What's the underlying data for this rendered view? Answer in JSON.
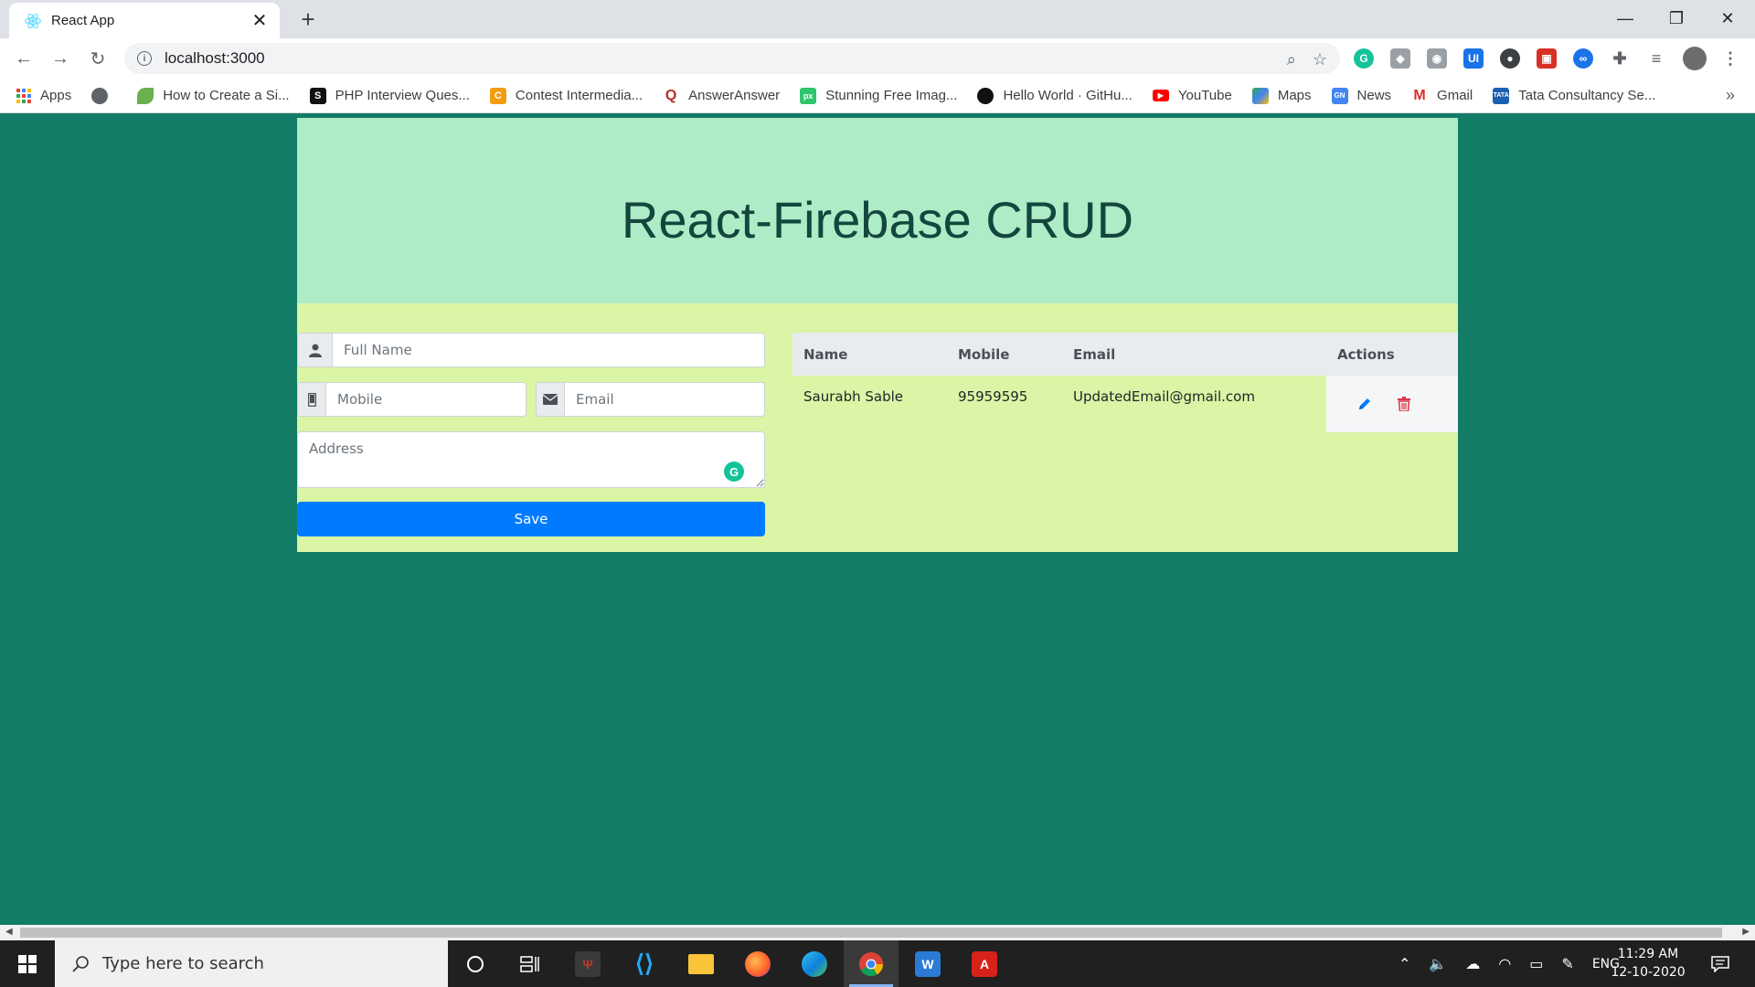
{
  "browser": {
    "tab_title": "React App",
    "url": "localhost:3000",
    "bookmarks": [
      {
        "label": "Apps",
        "icon": "apps-grid-icon",
        "color": "#ea4335"
      },
      {
        "label": "",
        "icon": "globe-icon",
        "color": "#5f6368"
      },
      {
        "label": "How to Create a Si...",
        "icon": "leaf-icon",
        "color": "#6ab04c"
      },
      {
        "label": "PHP Interview Ques...",
        "icon": "s-icon",
        "color": "#111111"
      },
      {
        "label": "Contest Intermedia...",
        "icon": "codechef-icon",
        "color": "#f39c12"
      },
      {
        "label": "AnswerAnswer",
        "icon": "quora-icon",
        "color": "#b92b27"
      },
      {
        "label": "Stunning Free Imag...",
        "icon": "pixabay-icon",
        "color": "#2ec66e"
      },
      {
        "label": "Hello World · GitHu...",
        "icon": "github-icon",
        "color": "#111111"
      },
      {
        "label": "YouTube",
        "icon": "youtube-icon",
        "color": "#ff0000"
      },
      {
        "label": "Maps",
        "icon": "maps-icon",
        "color": "#34a853"
      },
      {
        "label": "News",
        "icon": "news-icon",
        "color": "#4285f4"
      },
      {
        "label": "Gmail",
        "icon": "gmail-icon",
        "color": "#d93025"
      },
      {
        "label": "Tata Consultancy Se...",
        "icon": "tata-icon",
        "color": "#1c5fb0"
      }
    ]
  },
  "page": {
    "title": "React-Firebase CRUD",
    "form": {
      "fullname_placeholder": "Full Name",
      "mobile_placeholder": "Mobile",
      "email_placeholder": "Email",
      "address_placeholder": "Address",
      "save_label": "Save"
    },
    "table": {
      "headers": [
        "Name",
        "Mobile",
        "Email",
        "Actions"
      ],
      "rows": [
        {
          "name": "Saurabh Sable",
          "mobile": "95959595",
          "email": "UpdatedEmail@gmail.com"
        }
      ]
    },
    "colors": {
      "background": "#127c66",
      "jumbotron": "#aeebc7",
      "container": "#d9f5a5",
      "save_button": "#007bff",
      "edit_icon": "#007bff",
      "delete_icon": "#dc3545"
    }
  },
  "taskbar": {
    "search_placeholder": "Type here to search",
    "language": "ENG",
    "time": "11:29 AM",
    "date": "12-10-2020"
  }
}
